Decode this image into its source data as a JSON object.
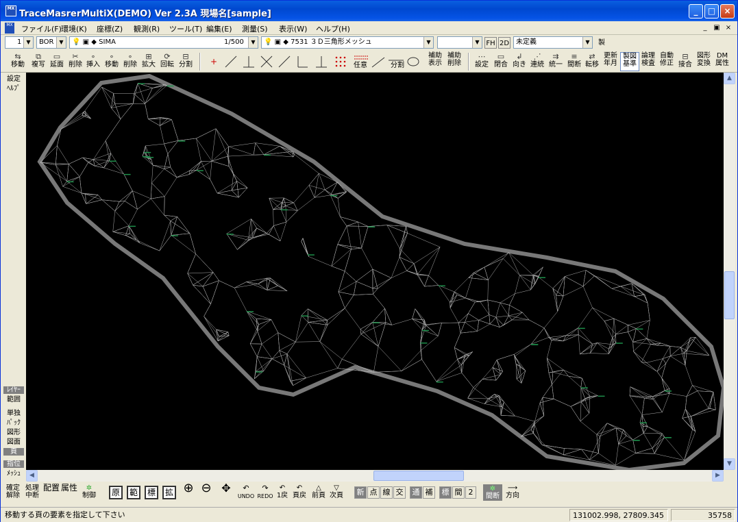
{
  "window": {
    "title": "TraceMasrerMultiX(DEMO) Ver 2.3A  現場名[sample]",
    "app_icon_text": "MX"
  },
  "menu": [
    "ファイル(F)",
    "環境(K)",
    "座標(Z)",
    "観測(R)",
    "ツール(T)",
    "編集(E)",
    "測量(S)",
    "表示(W)",
    "ヘルプ(H)"
  ],
  "layerbar": {
    "layer_no": "1",
    "layer_code": "BOR",
    "layer1_name": "SIMA",
    "scale": "1/500",
    "layer2_name": "7531 ３Ｄ三角形メッシュ",
    "layer3_name": "",
    "fh_label": "FH",
    "twod_label": "2D",
    "attr_value": "未定義",
    "make_label": "製"
  },
  "toolbar": [
    {
      "id": "move-copy",
      "l1": "移動",
      "l2": "",
      "ic": "⇆"
    },
    {
      "id": "copy",
      "l1": "複写",
      "l2": "",
      "ic": "⧉"
    },
    {
      "id": "extend",
      "l1": "延面",
      "l2": "",
      "ic": "▭"
    },
    {
      "id": "cut-delete",
      "l1": "削除",
      "l2": "",
      "ic": "✂"
    },
    {
      "id": "insert",
      "l1": "挿入",
      "l2": "",
      "ic": "∘"
    },
    {
      "id": "move",
      "l1": "移動",
      "l2": "",
      "ic": "∘"
    },
    {
      "id": "delete",
      "l1": "削除",
      "l2": "",
      "ic": "∘"
    },
    {
      "id": "expand",
      "l1": "拡大",
      "l2": "",
      "ic": "⊞"
    },
    {
      "id": "rotate",
      "l1": "回転",
      "l2": "",
      "ic": "⟳"
    },
    {
      "id": "split",
      "l1": "分割",
      "l2": "",
      "ic": "⊟"
    },
    {
      "id": "aux-show",
      "l1": "補助",
      "l2": "表示",
      "ic": ""
    },
    {
      "id": "aux-delete",
      "l1": "補助",
      "l2": "削除",
      "ic": ""
    },
    {
      "id": "setting",
      "l1": "設定",
      "l2": "",
      "ic": "⋯"
    },
    {
      "id": "close",
      "l1": "閉合",
      "l2": "",
      "ic": "▭"
    },
    {
      "id": "direction",
      "l1": "向き",
      "l2": "",
      "ic": "↲"
    },
    {
      "id": "connect",
      "l1": "連続",
      "l2": "",
      "ic": "⋰"
    },
    {
      "id": "unify",
      "l1": "統一",
      "l2": "",
      "ic": "⇉"
    },
    {
      "id": "interval",
      "l1": "間断",
      "l2": "",
      "ic": "≡"
    },
    {
      "id": "transfer",
      "l1": "転移",
      "l2": "",
      "ic": "⇄"
    },
    {
      "id": "update-date",
      "l1": "更新",
      "l2": "年月",
      "ic": ""
    },
    {
      "id": "drawing-base",
      "l1": "製図",
      "l2": "基準",
      "ic": ""
    },
    {
      "id": "logic-check",
      "l1": "論理",
      "l2": "検査",
      "ic": ""
    },
    {
      "id": "auto-fix",
      "l1": "自動",
      "l2": "修正",
      "ic": ""
    },
    {
      "id": "join",
      "l1": "接合",
      "l2": "",
      "ic": "⊟"
    },
    {
      "id": "shape-convert",
      "l1": "図形",
      "l2": "変換",
      "ic": ""
    },
    {
      "id": "dm-attr",
      "l1": "DM",
      "l2": "属性",
      "ic": ""
    }
  ],
  "draw_tools": {
    "any": "任意",
    "split2": "分割"
  },
  "leftpanel": {
    "settings": "設定",
    "help": "ﾍﾙﾌﾟ",
    "layer": "ﾚｲﾔｰ",
    "range": "範囲",
    "single": "単独",
    "pack": "ﾊﾟｯｸ",
    "shape": "図形",
    "diagram": "図面",
    "page": "頁",
    "point_spec": "指位",
    "mesh": "ﾒｯｼｭ"
  },
  "bottombar": {
    "confirm": [
      "確定",
      "解除"
    ],
    "process": [
      "処理",
      "中断"
    ],
    "place": "配置",
    "attr": "属性",
    "control": "制御",
    "orig": "原",
    "range": "範",
    "label": "標",
    "expand": "拡",
    "undo": "UNDO",
    "redo": "REDO",
    "one_back": "1戻",
    "page_back": "頁戻",
    "prev_page": "前頁",
    "next_page": "次頁",
    "new": "新",
    "point": "点",
    "line": "線",
    "cross": "交",
    "through": "通",
    "aux": "補",
    "std": "標",
    "interval": "間",
    "two": "2",
    "gap": "間断",
    "dir": "方向"
  },
  "status": {
    "message": "移動する頁の要素を指定して下さい",
    "coords": "131002.998,  27809.345",
    "count": "35758"
  }
}
